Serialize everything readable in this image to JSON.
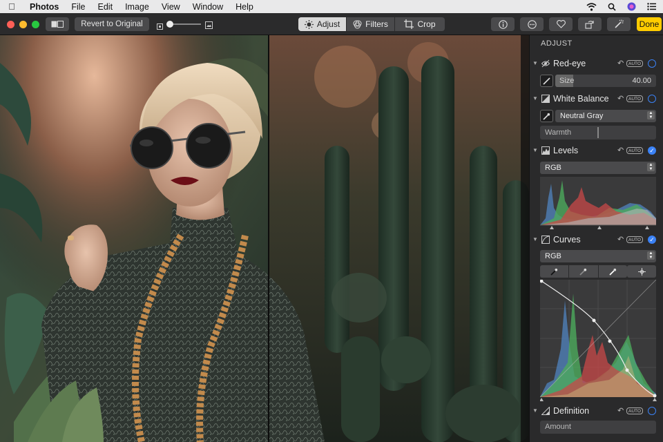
{
  "menubar": {
    "app_name": "Photos",
    "items": [
      "File",
      "Edit",
      "Image",
      "View",
      "Window",
      "Help"
    ]
  },
  "toolbar": {
    "revert_label": "Revert to Original",
    "tabs": [
      {
        "label": "Adjust",
        "active": true
      },
      {
        "label": "Filters",
        "active": false
      },
      {
        "label": "Crop",
        "active": false
      }
    ],
    "done_label": "Done",
    "zoom_level": 0.1
  },
  "sidebar": {
    "title": "ADJUST",
    "auto_label": "AUTO",
    "red_eye": {
      "label": "Red-eye",
      "size_label": "Size",
      "size_value": "40.00",
      "enabled": false
    },
    "white_balance": {
      "label": "White Balance",
      "preset": "Neutral Gray",
      "warmth_label": "Warmth",
      "enabled": false
    },
    "levels": {
      "label": "Levels",
      "channel": "RGB",
      "enabled": true
    },
    "curves": {
      "label": "Curves",
      "channel": "RGB",
      "enabled": true
    },
    "definition": {
      "label": "Definition",
      "amount_label": "Amount",
      "enabled": false
    }
  },
  "colors": {
    "accent": "#3b82f6",
    "done": "#ffcc00",
    "toolbar": "#2b2b2c",
    "sidebar": "#2a2a2b"
  }
}
